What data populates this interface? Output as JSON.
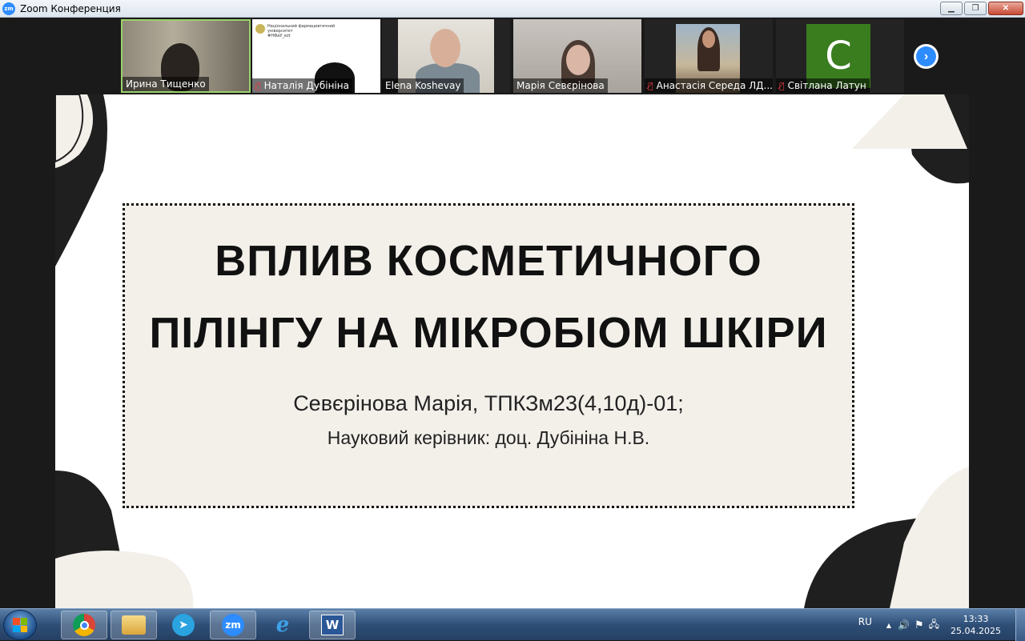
{
  "window": {
    "title": "Zoom Конференция",
    "logo_text": "zm",
    "minimize": "▁",
    "maximize": "❐",
    "close": "✕"
  },
  "participants": [
    {
      "name": "Ирина Тищенко",
      "muted": false
    },
    {
      "name": "Наталія Дубініна",
      "muted": true,
      "shared_lines": [
        "Національний фармацевтичний",
        "університет",
        "#НФаУ_ezt"
      ]
    },
    {
      "name": "Elena Koshevay",
      "muted": false
    },
    {
      "name": "Марія Севєрінова",
      "muted": false
    },
    {
      "name": "Анастасія Середа ЛД...",
      "muted": true
    },
    {
      "name": "Світлана Латун",
      "muted": true,
      "avatar_letter": "C"
    }
  ],
  "next_button": "›",
  "slide": {
    "title_line1": "ВПЛИВ КОСМЕТИЧНОГО",
    "title_line2": "ПІЛІНГУ НА МІКРОБІОМ ШКІРИ",
    "author_line": "Севєрінова Марія,  ТПКЗм23(4,10д)-01;",
    "supervisor_line": "Науковий керівник: доц. Дубініна Н.В."
  },
  "taskbar": {
    "apps": [
      "chrome-icon",
      "file-explorer-icon",
      "telegram-icon",
      "zoom-icon",
      "internet-explorer-icon",
      "word-icon"
    ],
    "zoom_label": "zm",
    "word_label": "W",
    "language": "RU",
    "time": "13:33",
    "date": "25.04.2025",
    "tray_up": "▲",
    "volume": "🔊",
    "action_flag": "⚑",
    "network": "🖧"
  },
  "colors": {
    "zoom_blue": "#2d8cff",
    "slide_box": "#f3f0ea",
    "avatar_green": "#3a7d1f",
    "speaker_border": "#9bd26a"
  }
}
